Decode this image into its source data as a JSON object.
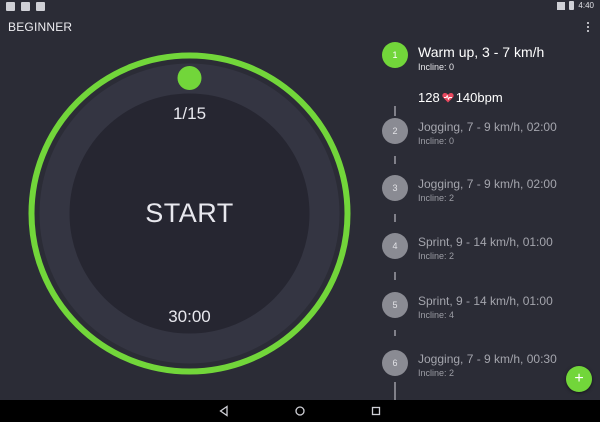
{
  "status_bar": {
    "time": "4:40"
  },
  "app_bar": {
    "title": "BEGINNER"
  },
  "timer": {
    "counter": "1/15",
    "start_label": "START",
    "duration": "30:00",
    "progress": 0.0
  },
  "steps": [
    {
      "number": "1",
      "title": "Warm up, 3 - 7 km/h",
      "incline": "Incline: 0",
      "active": true
    },
    {
      "number": "2",
      "title": "Jogging, 7 - 9 km/h, 02:00",
      "incline": "Incline: 0",
      "active": false
    },
    {
      "number": "3",
      "title": "Jogging, 7 - 9 km/h, 02:00",
      "incline": "Incline: 2",
      "active": false
    },
    {
      "number": "4",
      "title": "Sprint, 9 - 14 km/h, 01:00",
      "incline": "Incline: 2",
      "active": false
    },
    {
      "number": "5",
      "title": "Sprint, 9 - 14 km/h, 01:00",
      "incline": "Incline: 4",
      "active": false
    },
    {
      "number": "6",
      "title": "Jogging, 7 - 9 km/h, 00:30",
      "incline": "Incline: 2",
      "active": false
    }
  ],
  "heart_rate": {
    "low": "128",
    "high": "140bpm"
  },
  "fab": {
    "label": "+"
  },
  "colors": {
    "accent": "#72d63a",
    "background": "#2b2c36",
    "dial_inner": "#262631",
    "step_inactive": "#8a8b93",
    "heart": "#e8485f"
  },
  "icons": [
    "overflow-menu-icon",
    "heart-icon",
    "back-icon",
    "home-icon",
    "recents-icon",
    "add-icon"
  ]
}
